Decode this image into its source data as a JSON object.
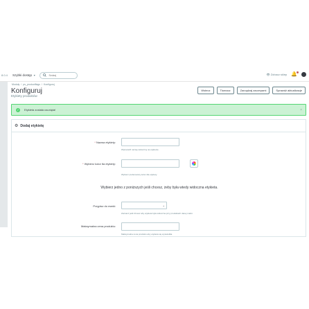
{
  "topbar": {
    "version": "8.0.4",
    "quick_access": "Szybki dostęp",
    "search_placeholder": "Szukaj",
    "view_shop": "Zobacz sklep"
  },
  "breadcrumb": [
    "Moduły",
    "ps_productflags",
    "Konfiguruj"
  ],
  "page": {
    "title": "Konfiguruj",
    "subtitle": "Etykiety produktów"
  },
  "toolbar": {
    "back": "Wstecz",
    "translate": "Tłumacz",
    "manage_hooks": "Zarządzaj zaczepami",
    "check_updates": "Sprawdź aktualizacje"
  },
  "alert": {
    "message": "Etykieta została usunięta!"
  },
  "panel": {
    "title": "Dodaj etykietę",
    "name_label": "Nazwa etykiety:",
    "name_help": "Wprowadź nazwę widoczną na etykiecie.",
    "color_label": "Wybierz kolor tła etykiety:",
    "color_help": "Wybierz preferowany kolor dla etykiety.",
    "info_text": "Wybierz jedno z poniższych jeśli chcesz, żeby była wtedy widoczna etykieta.",
    "brand_label": "Przypisz do marki:",
    "brand_help": "Zaznacz jeśli chcesz aby etykieta była widoczna przy produktach danej marki.",
    "max_price_label": "Maksymalna cena produktu:",
    "max_price_help": "Maksymalna cena produktu aby etykieta się wyświetliła."
  },
  "colors": {
    "success": "#53d572",
    "alert_bg": "#cbf2d4",
    "required": "#c05c67"
  }
}
